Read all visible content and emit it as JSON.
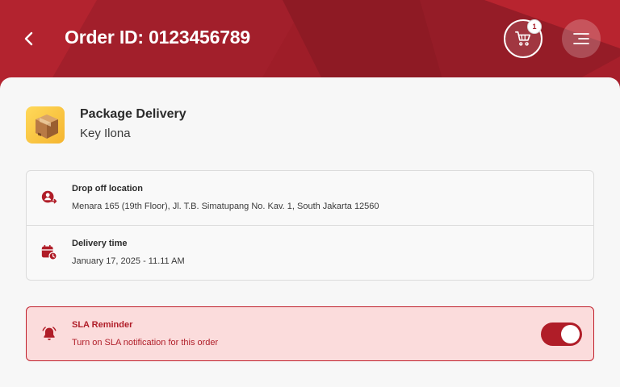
{
  "header": {
    "title": "Order ID: 0123456789",
    "back_icon": "chevron-left-icon",
    "cart_icon": "cart-icon",
    "cart_count": "1",
    "menu_icon": "menu-icon"
  },
  "package": {
    "icon": "package-box-icon",
    "title": "Package Delivery",
    "name": "Key Ilona"
  },
  "details": [
    {
      "icon": "location-person-icon",
      "label": "Drop off location",
      "value": "Menara 165 (19th Floor), Jl. T.B. Simatupang No. Kav. 1, South Jakarta 12560"
    },
    {
      "icon": "calendar-clock-icon",
      "label": "Delivery time",
      "value": "January 17, 2025 - 11.11 AM"
    }
  ],
  "sla": {
    "icon": "bell-icon",
    "label": "SLA Reminder",
    "subtitle": "Turn on SLA notification for this order",
    "enabled": true
  },
  "colors": {
    "brand": "#a81f2a",
    "sla_background": "#fbdcdc",
    "sheet_background": "#f7f7f7"
  }
}
